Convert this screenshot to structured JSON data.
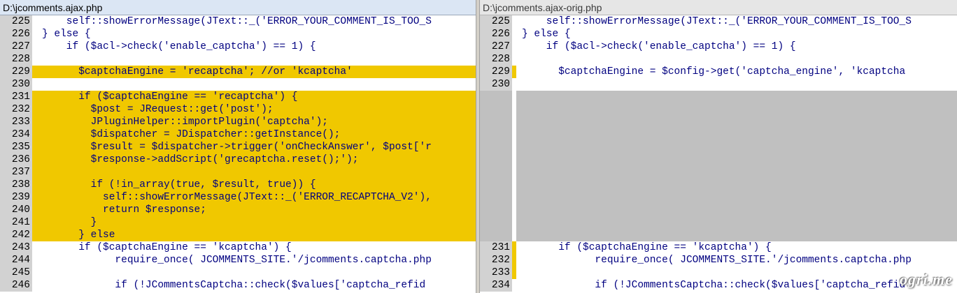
{
  "left": {
    "title": "D:\\jcomments.ajax.php",
    "lines": [
      {
        "n": "225",
        "t": "    self::showErrorMessage(JText::_('ERROR_YOUR_COMMENT_IS_TOO_S",
        "k": "normal"
      },
      {
        "n": "226",
        "t": "} else {",
        "k": "normal"
      },
      {
        "n": "227",
        "t": "    if ($acl->check('enable_captcha') == 1) {",
        "k": "normal"
      },
      {
        "n": "228",
        "t": "",
        "k": "normal"
      },
      {
        "n": "229",
        "t": "      $captchaEngine = 'recaptcha'; //or 'kcaptcha'",
        "k": "changed"
      },
      {
        "n": "230",
        "t": "",
        "k": "normal"
      },
      {
        "n": "231",
        "t": "      if ($captchaEngine == 'recaptcha') {",
        "k": "changed"
      },
      {
        "n": "232",
        "t": "        $post = JRequest::get('post');",
        "k": "changed"
      },
      {
        "n": "233",
        "t": "        JPluginHelper::importPlugin('captcha');",
        "k": "changed"
      },
      {
        "n": "234",
        "t": "        $dispatcher = JDispatcher::getInstance();",
        "k": "changed"
      },
      {
        "n": "235",
        "t": "        $result = $dispatcher->trigger('onCheckAnswer', $post['r",
        "k": "changed"
      },
      {
        "n": "236",
        "t": "        $response->addScript('grecaptcha.reset();');",
        "k": "changed"
      },
      {
        "n": "237",
        "t": "",
        "k": "changed"
      },
      {
        "n": "238",
        "t": "        if (!in_array(true, $result, true)) {",
        "k": "changed"
      },
      {
        "n": "239",
        "t": "          self::showErrorMessage(JText::_('ERROR_RECAPTCHA_V2'),",
        "k": "changed"
      },
      {
        "n": "240",
        "t": "          return $response;",
        "k": "changed"
      },
      {
        "n": "241",
        "t": "        }",
        "k": "changed"
      },
      {
        "n": "242",
        "t": "      } else",
        "k": "changed"
      },
      {
        "n": "243",
        "t": "      if ($captchaEngine == 'kcaptcha') {",
        "k": "normal"
      },
      {
        "n": "244",
        "t": "            require_once( JCOMMENTS_SITE.'/jcomments.captcha.php",
        "k": "normal"
      },
      {
        "n": "245",
        "t": "",
        "k": "normal"
      },
      {
        "n": "246",
        "t": "            if (!JCommentsCaptcha::check($values['captcha_refid",
        "k": "normal"
      }
    ]
  },
  "right": {
    "title": "D:\\jcomments.ajax-orig.php",
    "lines": [
      {
        "n": "225",
        "t": "    self::showErrorMessage(JText::_('ERROR_YOUR_COMMENT_IS_TOO_S",
        "k": "normal"
      },
      {
        "n": "226",
        "t": "} else {",
        "k": "normal"
      },
      {
        "n": "227",
        "t": "    if ($acl->check('enable_captcha') == 1) {",
        "k": "normal"
      },
      {
        "n": "228",
        "t": "",
        "k": "normal"
      },
      {
        "n": "229",
        "t": "      $captchaEngine = $config->get('captcha_engine', 'kcaptcha",
        "k": "marked"
      },
      {
        "n": "230",
        "t": "",
        "k": "normal"
      },
      {
        "n": "",
        "t": "",
        "k": "empty"
      },
      {
        "n": "",
        "t": "",
        "k": "empty"
      },
      {
        "n": "",
        "t": "",
        "k": "empty"
      },
      {
        "n": "",
        "t": "",
        "k": "empty"
      },
      {
        "n": "",
        "t": "",
        "k": "empty"
      },
      {
        "n": "",
        "t": "",
        "k": "empty"
      },
      {
        "n": "",
        "t": "",
        "k": "empty"
      },
      {
        "n": "",
        "t": "",
        "k": "empty"
      },
      {
        "n": "",
        "t": "",
        "k": "empty"
      },
      {
        "n": "",
        "t": "",
        "k": "empty"
      },
      {
        "n": "",
        "t": "",
        "k": "empty"
      },
      {
        "n": "",
        "t": "",
        "k": "empty"
      },
      {
        "n": "231",
        "t": "      if ($captchaEngine == 'kcaptcha') {",
        "k": "marked"
      },
      {
        "n": "232",
        "t": "            require_once( JCOMMENTS_SITE.'/jcomments.captcha.php",
        "k": "marked"
      },
      {
        "n": "233",
        "t": "",
        "k": "marked"
      },
      {
        "n": "234",
        "t": "            if (!JCommentsCaptcha::check($values['captcha_refid",
        "k": "normal"
      }
    ]
  },
  "watermark": "ogri.me",
  "colors": {
    "changed": "#f0c800",
    "empty": "#c0c0c0",
    "linenum_bg": "#d2d2d2",
    "code_text": "#000080"
  }
}
